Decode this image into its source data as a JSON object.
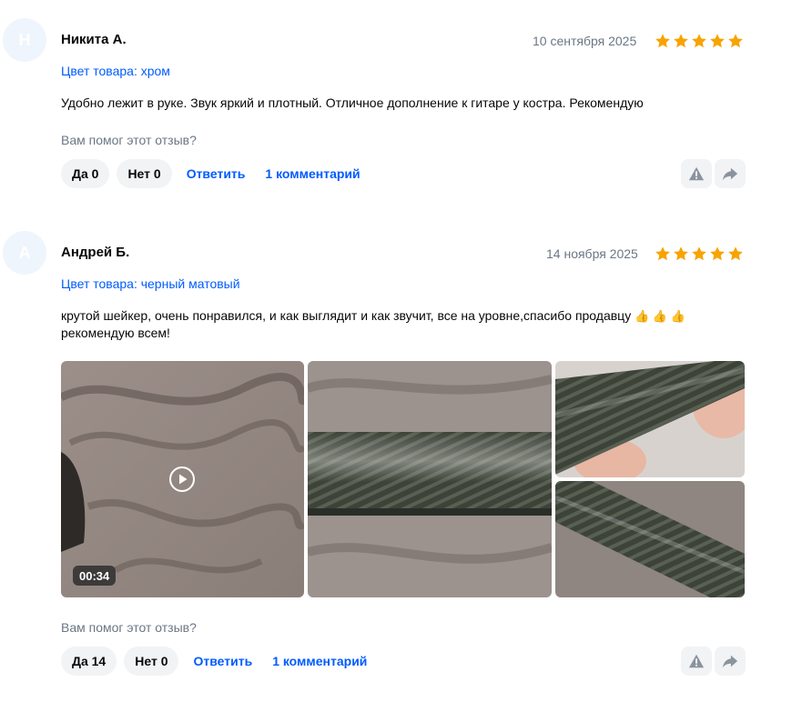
{
  "reviews": [
    {
      "avatar_letter": "Н",
      "author": "Никита А.",
      "date": "10 сентября 2025",
      "rating": 5,
      "variant": "Цвет товара: хром",
      "text": "Удобно лежит в руке. Звук яркий и плотный. Отличное дополнение к гитаре у костра. Рекомендую",
      "helpful_question": "Вам помог этот отзыв?",
      "yes_label": "Да 0",
      "no_label": "Нет 0",
      "reply_label": "Ответить",
      "comments_label": "1 комментарий"
    },
    {
      "avatar_letter": "А",
      "author": "Андрей Б.",
      "date": "14 ноября 2025",
      "rating": 5,
      "variant": "Цвет товара: черный матовый",
      "text_line1": "крутой шейкер, очень понравился, и как выглядит и как звучит, все на уровне,спасибо продавцу",
      "emojis": "👍 👍 👍",
      "text_line2": "рекомендую всем!",
      "video_duration": "00:34",
      "helpful_question": "Вам помог этот отзыв?",
      "yes_label": "Да 14",
      "no_label": "Нет 0",
      "reply_label": "Ответить",
      "comments_label": "1 комментарий"
    }
  ],
  "colors": {
    "link": "#005bff",
    "star": "#f8a300",
    "muted_text": "#6b7785",
    "button_bg": "#f2f3f5"
  },
  "icons": [
    "star-icon",
    "report-icon",
    "share-icon",
    "play-icon"
  ]
}
